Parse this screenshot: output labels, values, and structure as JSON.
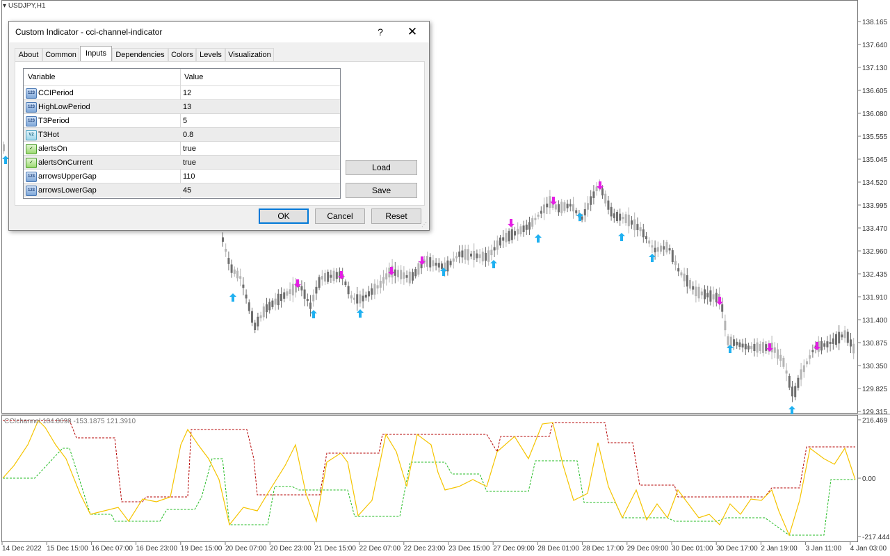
{
  "chart": {
    "symbol_title": "USDJPY,H1",
    "price_ticks": [
      "138.165",
      "137.640",
      "137.130",
      "136.605",
      "136.080",
      "135.555",
      "135.045",
      "134.520",
      "133.995",
      "133.470",
      "132.960",
      "132.435",
      "131.910",
      "131.400",
      "130.875",
      "130.350",
      "129.825",
      "129.315"
    ],
    "indicator_label": "CCIchannel 184.8698 -153.1875 121.3910",
    "indicator_ticks": [
      "216.469",
      "0.00",
      "-217.4441"
    ],
    "time_ticks": [
      "14 Dec 2022",
      "15 Dec 15:00",
      "16 Dec 07:00",
      "16 Dec 23:00",
      "19 Dec 15:00",
      "20 Dec 07:00",
      "20 Dec 23:00",
      "21 Dec 15:00",
      "22 Dec 07:00",
      "22 Dec 23:00",
      "23 Dec 15:00",
      "27 Dec 09:00",
      "28 Dec 01:00",
      "28 Dec 17:00",
      "29 Dec 09:00",
      "30 Dec 01:00",
      "30 Dec 17:00",
      "2 Jan 19:00",
      "3 Jan 11:00",
      "4 Jan 03:00"
    ],
    "colors": {
      "bull_candle": "#b4b4b4",
      "bear_candle": "#6e6e6e",
      "arrow_up": "#1fb0f0",
      "arrow_down": "#e41ee4",
      "cci_line": "#f5c400",
      "upper_band": "#b40000",
      "lower_band": "#22bb22"
    },
    "icons": {
      "arrow_up": "arrow-up-icon",
      "arrow_down": "arrow-down-icon"
    }
  },
  "dialog": {
    "title": "Custom Indicator - cci-channel-indicator",
    "help_label": "?",
    "close_label": "✕",
    "tabs": [
      {
        "label": "About"
      },
      {
        "label": "Common"
      },
      {
        "label": "Inputs",
        "active": true
      },
      {
        "label": "Dependencies"
      },
      {
        "label": "Colors"
      },
      {
        "label": "Levels"
      },
      {
        "label": "Visualization"
      }
    ],
    "grid": {
      "col_variable": "Variable",
      "col_value": "Value",
      "rows": [
        {
          "icon": "int",
          "icon_text": "123",
          "name": "CCIPeriod",
          "value": "12"
        },
        {
          "icon": "int",
          "icon_text": "123",
          "name": "HighLowPeriod",
          "value": "13"
        },
        {
          "icon": "int",
          "icon_text": "123",
          "name": "T3Period",
          "value": "5"
        },
        {
          "icon": "dbl",
          "icon_text": "V2",
          "name": "T3Hot",
          "value": "0.8"
        },
        {
          "icon": "bool",
          "icon_text": "✓",
          "name": "alertsOn",
          "value": "true"
        },
        {
          "icon": "bool",
          "icon_text": "✓",
          "name": "alertsOnCurrent",
          "value": "true"
        },
        {
          "icon": "int",
          "icon_text": "123",
          "name": "arrowsUpperGap",
          "value": "110"
        },
        {
          "icon": "int",
          "icon_text": "123",
          "name": "arrowsLowerGap",
          "value": "45"
        }
      ]
    },
    "load_label": "Load",
    "save_label": "Save",
    "ok_label": "OK",
    "cancel_label": "Cancel",
    "reset_label": "Reset"
  }
}
